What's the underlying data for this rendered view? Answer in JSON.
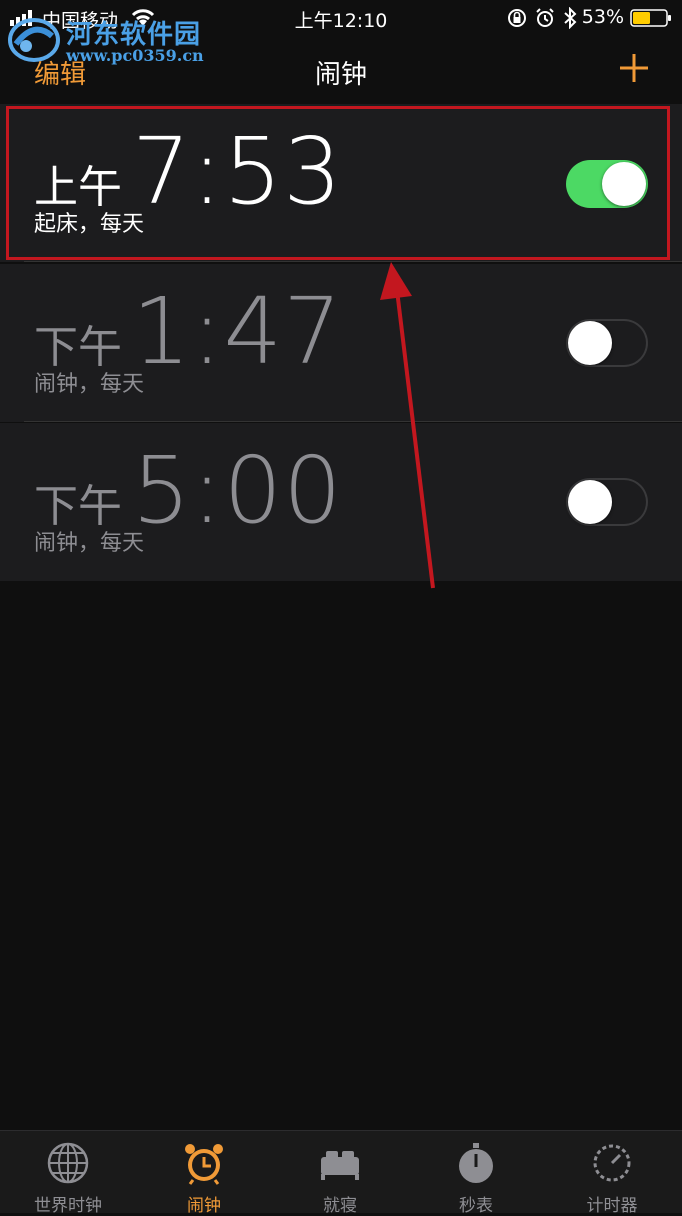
{
  "status_bar": {
    "carrier": "中国移动",
    "time": "上午12:10",
    "battery_percent": "53%",
    "battery_level": 0.53
  },
  "watermark": {
    "name": "河东软件园",
    "url": "www.pc0359.cn"
  },
  "nav": {
    "edit_label": "编辑",
    "title": "闹钟",
    "add_icon": "plus-icon"
  },
  "alarms": [
    {
      "ampm": "上午",
      "time": "7:53",
      "label": "起床，每天",
      "enabled": true
    },
    {
      "ampm": "下午",
      "time": "1:47",
      "label": "闹钟，每天",
      "enabled": false
    },
    {
      "ampm": "下午",
      "time": "5:00",
      "label": "闹钟，每天",
      "enabled": false
    }
  ],
  "tabs": [
    {
      "label": "世界时钟",
      "icon": "globe-icon",
      "active": false
    },
    {
      "label": "闹钟",
      "icon": "alarm-clock-icon",
      "active": true
    },
    {
      "label": "就寝",
      "icon": "bed-icon",
      "active": false
    },
    {
      "label": "秒表",
      "icon": "stopwatch-icon",
      "active": false
    },
    {
      "label": "计时器",
      "icon": "timer-icon",
      "active": false
    }
  ],
  "colors": {
    "accent": "#f09a37",
    "toggle_on": "#4cd964",
    "annotation": "#c3171f",
    "row_bg": "#1c1c1e",
    "background": "#0f0f0f"
  }
}
